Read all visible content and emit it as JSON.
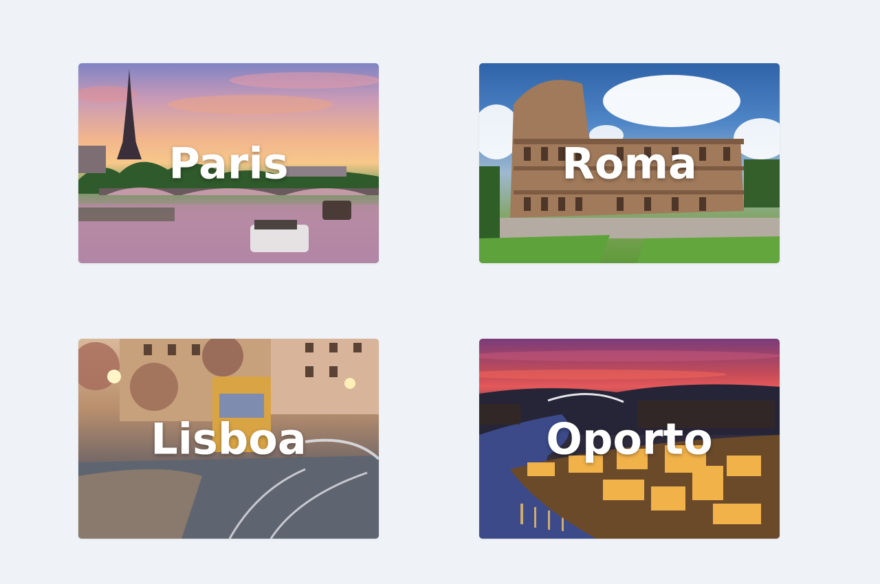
{
  "cities": [
    {
      "name": "Paris"
    },
    {
      "name": "Roma"
    },
    {
      "name": "Lisboa"
    },
    {
      "name": "Oporto"
    }
  ]
}
